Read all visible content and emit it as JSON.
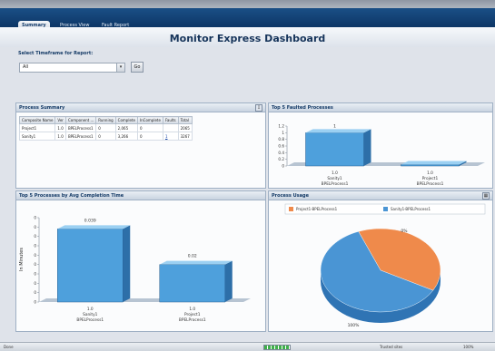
{
  "tabs": [
    {
      "label": "Summary",
      "active": true
    },
    {
      "label": "Process View",
      "active": false
    },
    {
      "label": "Fault Report",
      "active": false
    }
  ],
  "page_title": "Monitor Express Dashboard",
  "timeframe": {
    "label": "Select Timeframe for Report:",
    "selected": "All",
    "go_label": "Go"
  },
  "process_summary": {
    "title": "Process Summary",
    "columns": [
      "Composite Name",
      "Ver",
      "Component ...",
      "Running",
      "Complete",
      "InComplete",
      "Faults",
      "Total"
    ],
    "rows": [
      [
        "Project1",
        "1.0",
        "BPELProcess1",
        "0",
        "2,065",
        "0",
        "",
        "2065"
      ],
      [
        "Sanity1",
        "1.0",
        "BPELProcess1",
        "0",
        "3,266",
        "0",
        "1",
        "3267"
      ]
    ]
  },
  "faulted": {
    "title": "Top 5 Faulted Processes",
    "chart_data": {
      "type": "bar",
      "categories": [
        "1.0\nSanity1\nBPELProcess1",
        "1.0\nProject1\nBPELProcess1"
      ],
      "values": [
        1,
        0
      ],
      "data_labels": [
        "1",
        ""
      ],
      "ylim": [
        0,
        1.2
      ],
      "yticks": [
        "0",
        "0.2",
        "0.4",
        "0.6",
        "0.8",
        "1",
        "1.2"
      ]
    }
  },
  "avgtime": {
    "title": "Top 5 Processes by Avg Completion Time",
    "ylabel": "In Minutes",
    "chart_data": {
      "type": "bar",
      "categories": [
        "1.0\nSanity1\nBPELProcess1",
        "1.0\nProject1\nBPELProcess1"
      ],
      "values": [
        0.039,
        0.02
      ],
      "data_labels": [
        "0.039",
        "0.02"
      ],
      "ylim": [
        0,
        0.045
      ],
      "yticks": [
        "0",
        "0",
        "0",
        "0",
        "0",
        "0",
        "0",
        "0",
        "0",
        "0"
      ]
    }
  },
  "usage": {
    "title": "Process Usage",
    "chart_data": {
      "type": "pie",
      "series": [
        {
          "name": "Project1-BPELProcess1",
          "value": 0.39,
          "color": "#ef8a4b"
        },
        {
          "name": "Sanity1-BPELProcess1",
          "value": 0.61,
          "color": "#4a95d4"
        }
      ],
      "data_labels": [
        "0%",
        "100%"
      ]
    }
  },
  "footer": {
    "status_left": "Done",
    "zone": "Trusted sites",
    "zoom": "100%"
  },
  "colors": {
    "bar": "#4ea0dc",
    "bar_dark": "#2d6fa8",
    "bar_top": "#9bd0f2",
    "brand": "#143a66"
  }
}
